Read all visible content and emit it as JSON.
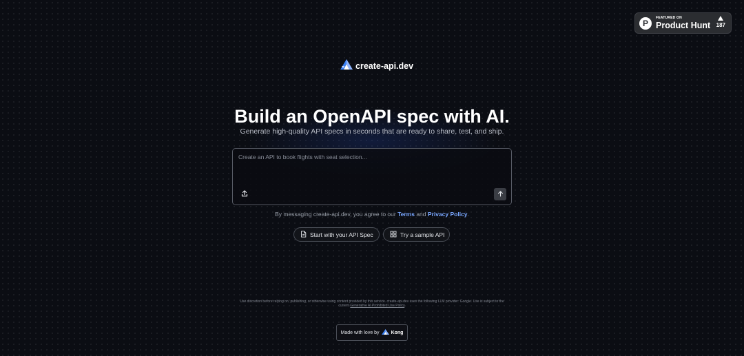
{
  "product_hunt": {
    "featured_on": "FEATURED ON",
    "name": "Product Hunt",
    "votes": "187",
    "logo_letter": "P"
  },
  "brand": {
    "name": "create-api.dev",
    "icon": "create-api-logo-icon"
  },
  "hero": {
    "title": "Build an OpenAPI spec with AI.",
    "subtitle": "Generate high-quality API specs in seconds that are ready to share, test, and ship."
  },
  "prompt": {
    "placeholder": "Create an API to book flights with seat selection...",
    "value": "",
    "upload_icon": "upload-icon",
    "send_icon": "arrow-up-icon"
  },
  "consent": {
    "prefix": "By messaging create-api.dev, you agree to our ",
    "terms": "Terms",
    "and": " and ",
    "privacy": "Privacy Policy",
    "suffix": "."
  },
  "actions": {
    "start_label": "Start with your API Spec",
    "start_icon": "document-icon",
    "sample_label": "Try a sample API",
    "sample_icon": "grid-icon"
  },
  "disclaimer": {
    "text": "Use discretion before relying on, publishing, or otherwise using content provided by this service. create-api.dev uses the following LLM provider: Google. Use is subject to the current ",
    "link": "Generative AI Prohibited Use Policy",
    "suffix": "."
  },
  "footer": {
    "made_with": "Made with love by",
    "company": "Kong"
  },
  "colors": {
    "background": "#0b0d13",
    "accent_link": "#7aa7ff",
    "brand_blue": "#3b82f6"
  }
}
